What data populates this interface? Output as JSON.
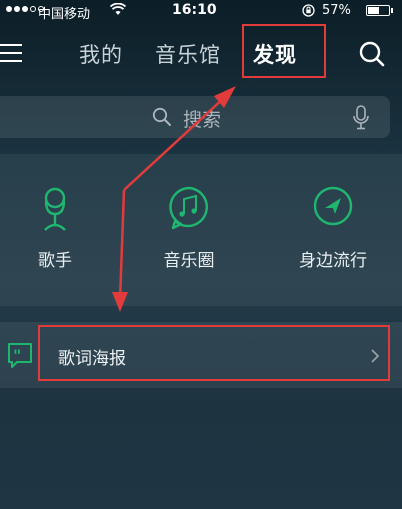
{
  "status_bar": {
    "carrier": "中国移动",
    "time": "16:10",
    "battery_percent": "57%",
    "battery_level": 0.57
  },
  "nav": {
    "tabs": [
      {
        "label": "我的"
      },
      {
        "label": "音乐馆"
      },
      {
        "label": "发现"
      }
    ],
    "active_tab": "发现"
  },
  "search": {
    "placeholder": "搜索"
  },
  "features": [
    {
      "label": "歌手",
      "icon": "singer-icon"
    },
    {
      "label": "音乐圈",
      "icon": "music-circle-icon"
    },
    {
      "label": "身边流行",
      "icon": "nearby-trending-icon"
    }
  ],
  "list": {
    "lyric_poster": {
      "label": "歌词海报",
      "icon": "quote-icon"
    }
  },
  "colors": {
    "accent_green": "#1fb66f",
    "annotation_red": "#e23b3b"
  }
}
